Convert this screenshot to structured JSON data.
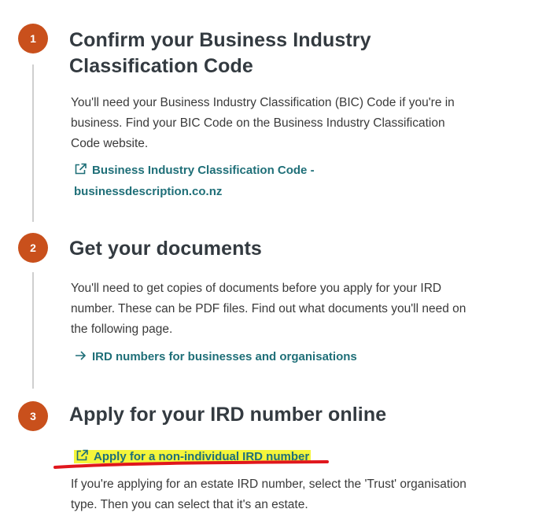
{
  "steps": [
    {
      "number": "1",
      "title_line1": "Confirm your Business Industry",
      "title_line2": "Classification Code",
      "text": "You'll need your Business Industry Classification (BIC) Code if you're in business. Find your BIC Code on the Business Industry Classification Code website.",
      "link_line1": "Business Industry Classification Code -",
      "link_line2": "businessdescription.co.nz",
      "link_icon": "external-link-icon"
    },
    {
      "number": "2",
      "title": "Get your documents",
      "text": "You'll need to get copies of documents before you apply for your IRD number. These can be PDF files. Find out what documents you'll need on the following page.",
      "link": "IRD numbers for businesses and organisations",
      "link_icon": "arrow-right-icon"
    },
    {
      "number": "3",
      "title": "Apply for your IRD number online",
      "link": "Apply for a non-individual IRD number",
      "link_icon": "external-link-icon",
      "text": "If you're applying for an estate IRD number, select the 'Trust' organisation type. Then you can select that it's an estate."
    }
  ],
  "colors": {
    "step_circle": "#c9501c",
    "link": "#1f6f78",
    "highlight": "#f5f53a",
    "annotation_underline": "#e0161c"
  }
}
